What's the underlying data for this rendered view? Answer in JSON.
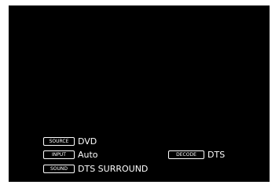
{
  "osd": {
    "source": {
      "tag": "SOURCE",
      "value": "DVD"
    },
    "input": {
      "tag": "INPUT",
      "value": "Auto"
    },
    "decode": {
      "tag": "DECODE",
      "value": "DTS"
    },
    "sound": {
      "tag": "SOUND",
      "value": "DTS SURROUND"
    }
  },
  "colors": {
    "background": "#000000",
    "text": "#ffffff",
    "frame": "#ffffff"
  }
}
